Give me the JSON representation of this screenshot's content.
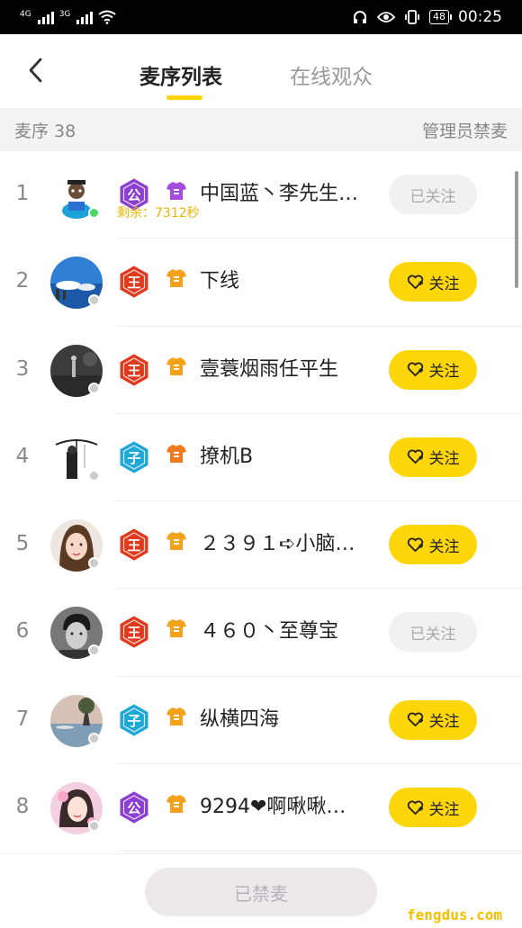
{
  "status_bar": {
    "net1": "4G",
    "net2": "3G",
    "battery": "48",
    "time": "00:25"
  },
  "header": {
    "tab_active": "麦序列表",
    "tab_inactive": "在线观众"
  },
  "subbar": {
    "left": "麦序 38",
    "right": "管理员禁麦"
  },
  "rows": [
    {
      "rank": "1",
      "name": "中国蓝丶李先生…",
      "badge": "公",
      "badge_color": "#8a3fd1",
      "shirt_color": "#a44be0",
      "remain": "剩余：7312秒",
      "button": "已关注",
      "followed": true,
      "online": true,
      "avatar": "avatar-1"
    },
    {
      "rank": "2",
      "name": "下线",
      "badge": "王",
      "badge_color": "#e03a1e",
      "shirt_color": "#f4a21c",
      "remain": "",
      "button": "关注",
      "followed": false,
      "online": false,
      "avatar": "avatar-2"
    },
    {
      "rank": "3",
      "name": "壹蓑烟雨任平生",
      "badge": "王",
      "badge_color": "#e03a1e",
      "shirt_color": "#f4a21c",
      "remain": "",
      "button": "关注",
      "followed": false,
      "online": false,
      "avatar": "avatar-3"
    },
    {
      "rank": "4",
      "name": "撩机B",
      "badge": "子",
      "badge_color": "#1fa7d6",
      "shirt_color": "#f07a1c",
      "remain": "",
      "button": "关注",
      "followed": false,
      "online": false,
      "avatar": "avatar-4"
    },
    {
      "rank": "5",
      "name": "２３９１➪小脑…",
      "badge": "王",
      "badge_color": "#e03a1e",
      "shirt_color": "#f4a21c",
      "remain": "",
      "button": "关注",
      "followed": false,
      "online": false,
      "avatar": "avatar-5"
    },
    {
      "rank": "6",
      "name": "４６０丶至尊宝",
      "badge": "王",
      "badge_color": "#e03a1e",
      "shirt_color": "#f4a21c",
      "remain": "",
      "button": "已关注",
      "followed": true,
      "online": false,
      "avatar": "avatar-6"
    },
    {
      "rank": "7",
      "name": "纵横四海",
      "badge": "子",
      "badge_color": "#1fa7d6",
      "shirt_color": "#f4a21c",
      "remain": "",
      "button": "关注",
      "followed": false,
      "online": false,
      "avatar": "avatar-7"
    },
    {
      "rank": "8",
      "name": "9294❤啊啾啾…",
      "badge": "公",
      "badge_color": "#8a3fd1",
      "shirt_color": "#f4a21c",
      "remain": "",
      "button": "关注",
      "followed": false,
      "online": false,
      "avatar": "avatar-8"
    }
  ],
  "footer": {
    "mute_button": "已禁麦",
    "watermark": "fengdus.com"
  },
  "colors": {
    "accent": "#ffd60a"
  }
}
